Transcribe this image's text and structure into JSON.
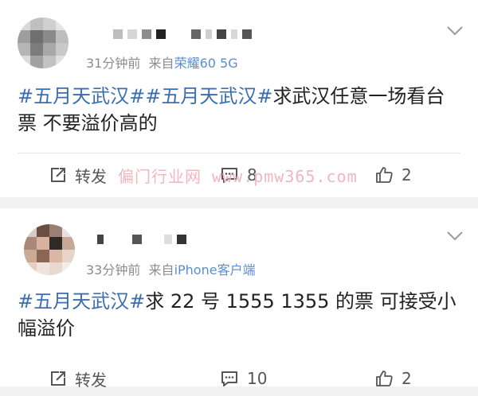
{
  "posts": [
    {
      "time": "31分钟前",
      "source_prefix": "来自",
      "source": "荣耀60 5G",
      "tags": [
        "#五月天武汉#",
        "#五月天武汉#"
      ],
      "text": "求武汉任意一场看台票 不要溢价高的",
      "repost_label": "转发",
      "comment_count": "8",
      "like_count": "2"
    },
    {
      "time": "33分钟前",
      "source_prefix": "来自",
      "source": "iPhone客户端",
      "tags": [
        "#五月天武汉#"
      ],
      "text": "求 22 号 1555 1355 的票  可接受小幅溢价",
      "repost_label": "转发",
      "comment_count": "10",
      "like_count": "2"
    }
  ],
  "watermark": "偏门行业网 www.pmw365.com",
  "colors": {
    "tag": "#3b6eb1",
    "source": "#5a8ecf",
    "meta": "#8c8c8c",
    "background": "#f2f2f2",
    "watermark": "#f3b6bd"
  },
  "icons": [
    "chevron-down-icon",
    "repost-icon",
    "comment-icon",
    "like-icon"
  ]
}
